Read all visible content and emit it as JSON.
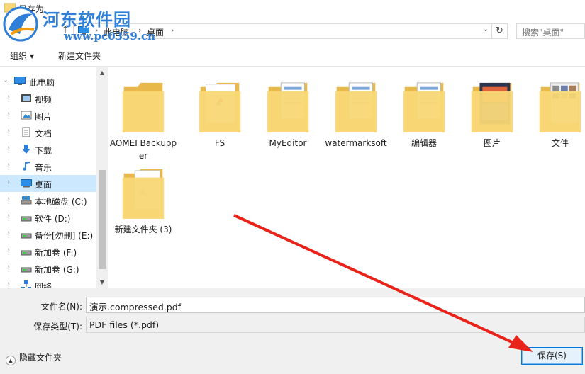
{
  "window": {
    "title": "另存为"
  },
  "watermark": {
    "brand": "河东软件园",
    "url": "www.pc0359.cn"
  },
  "address": {
    "crumbs": [
      "此电脑",
      "桌面"
    ],
    "search_placeholder": "搜索\"桌面\""
  },
  "toolbar": {
    "organize": "组织",
    "new_folder": "新建文件夹"
  },
  "nav": {
    "items": [
      {
        "label": "此电脑",
        "icon": "computer-icon",
        "expanded": true
      },
      {
        "label": "视频",
        "icon": "video-icon"
      },
      {
        "label": "图片",
        "icon": "pictures-icon"
      },
      {
        "label": "文档",
        "icon": "documents-icon"
      },
      {
        "label": "下载",
        "icon": "download-icon"
      },
      {
        "label": "音乐",
        "icon": "music-icon"
      },
      {
        "label": "桌面",
        "icon": "desktop-icon",
        "selected": true
      },
      {
        "label": "本地磁盘 (C:)",
        "icon": "system-drive-icon"
      },
      {
        "label": "软件 (D:)",
        "icon": "drive-icon"
      },
      {
        "label": "备份[勿删] (E:)",
        "icon": "drive-icon"
      },
      {
        "label": "新加卷 (F:)",
        "icon": "drive-icon"
      },
      {
        "label": "新加卷 (G:)",
        "icon": "drive-icon"
      },
      {
        "label": "网络",
        "icon": "network-icon"
      }
    ]
  },
  "folders": [
    {
      "label": "AOMEI Backupper",
      "variant": "empty"
    },
    {
      "label": "FS",
      "variant": "doc-logo"
    },
    {
      "label": "MyEditor",
      "variant": "docs"
    },
    {
      "label": "watermarksoft",
      "variant": "docs"
    },
    {
      "label": "编辑器",
      "variant": "docs"
    },
    {
      "label": "图片",
      "variant": "photo"
    },
    {
      "label": "文件",
      "variant": "photo-grid"
    },
    {
      "label": "新建文件夹 (3)",
      "variant": "paper"
    }
  ],
  "form": {
    "filename_label": "文件名(N):",
    "filename_value": "演示.compressed.pdf",
    "filetype_label": "保存类型(T):",
    "filetype_value": "PDF files (*.pdf)",
    "hide_folders": "隐藏文件夹",
    "save_button": "保存(S)"
  },
  "colors": {
    "selection": "#cce8ff",
    "accent": "#0078d7",
    "folder": "#f8d775",
    "arrow": "#e8231a"
  }
}
